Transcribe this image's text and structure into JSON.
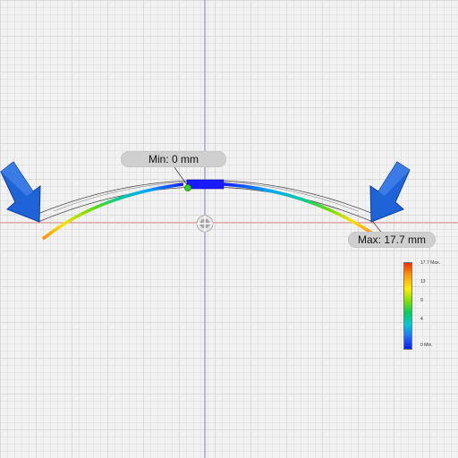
{
  "viewport": {
    "grid_color": "#d9d9d9",
    "major_grid_color": "#c3c3c3",
    "axis_y_color": "#7b7bd6",
    "axis_x_color": "#e08b8b"
  },
  "annotations": {
    "min_label": "Min: 0 mm",
    "max_label": "Max: 17.7 mm"
  },
  "legend": {
    "labels": [
      "17.7 Max.",
      "13",
      "9",
      "4",
      "0 Min."
    ]
  },
  "arrows": {
    "color": "#1a5fd0",
    "icons": [
      "load-arrow-icon",
      "load-arrow-icon"
    ]
  },
  "colors": {
    "deformed_min": "#1a1aff",
    "deformed_max": "#ff3300"
  }
}
